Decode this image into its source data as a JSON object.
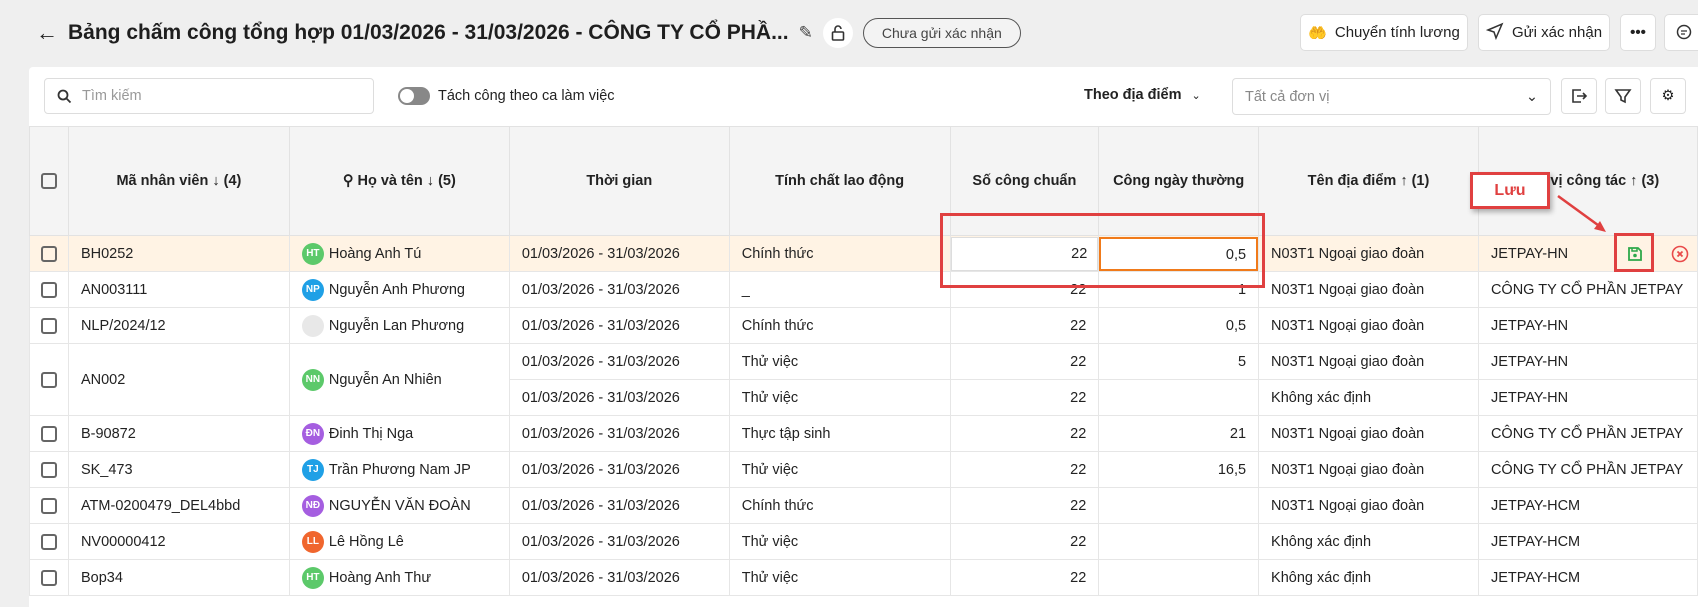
{
  "header": {
    "title": "Bảng chấm công tổng hợp 01/03/2026 - 31/03/2026 - CÔNG TY CỔ PHẦ...",
    "status": "Chưa gửi xác nhận",
    "transfer_label": "Chuyển tính lương",
    "send_label": "Gửi xác nhận"
  },
  "toolbar": {
    "search_placeholder": "Tìm kiếm",
    "split_toggle_label": "Tách công theo ca làm việc",
    "split_toggle_on": false,
    "group_by": "Theo địa điểm",
    "unit_placeholder": "Tất cả đơn vị"
  },
  "columns": [
    "Mã nhân viên ↓ (4)",
    "Họ và tên ↓ (5)",
    "Thời gian",
    "Tính chất lao động",
    "Số công chuẩn",
    "Công ngày thường",
    "Tên địa điểm ↑ (1)",
    "Đơn vị công tác ↑ (3)"
  ],
  "annotation": {
    "label": "Lưu",
    "color": "#e04040"
  },
  "colors": {
    "selected_row": "#fff3e4",
    "save": "#2ea84a",
    "cancel": "#e94a4a",
    "focus": "#f07a1a"
  },
  "rows": [
    {
      "code": "BH0252",
      "initials": "HT",
      "avatar_color": "#5cc96a",
      "name": "Hoàng Anh Tú",
      "period": "01/03/2026 - 31/03/2026",
      "type": "Chính thức",
      "standard": "22",
      "normal": "0,5",
      "location": "N03T1 Ngoại giao đoàn",
      "unit": "JETPAY-HN"
    },
    {
      "code": "AN003111",
      "initials": "NP",
      "avatar_color": "#1fa0e6",
      "name": "Nguyễn Anh Phương",
      "period": "01/03/2026 - 31/03/2026",
      "type": "_",
      "standard": "22",
      "normal": "1",
      "location": "N03T1 Ngoại giao đoàn",
      "unit": "CÔNG TY CỔ PHẦN JETPAY"
    },
    {
      "code": "NLP/2024/12",
      "initials": "",
      "avatar_color": "#e8e8e8",
      "name": "Nguyễn Lan Phương",
      "period": "01/03/2026 - 31/03/2026",
      "type": "Chính thức",
      "standard": "22",
      "normal": "0,5",
      "location": "N03T1 Ngoại giao đoàn",
      "unit": "JETPAY-HN"
    },
    {
      "code": "AN002",
      "initials": "NN",
      "avatar_color": "#5cc96a",
      "name": "Nguyễn An Nhiên",
      "sub": [
        {
          "period": "01/03/2026 - 31/03/2026",
          "type": "Thử việc",
          "standard": "22",
          "normal": "5",
          "location": "N03T1 Ngoại giao đoàn",
          "unit": "JETPAY-HN"
        },
        {
          "period": "01/03/2026 - 31/03/2026",
          "type": "Thử việc",
          "standard": "22",
          "normal": "",
          "location": "Không xác định",
          "unit": "JETPAY-HN"
        }
      ]
    },
    {
      "code": "B-90872",
      "initials": "ĐN",
      "avatar_color": "#a55ee0",
      "name": "Đinh Thị Nga",
      "period": "01/03/2026 - 31/03/2026",
      "type": "Thực tập sinh",
      "standard": "22",
      "normal": "21",
      "location": "N03T1 Ngoại giao đoàn",
      "unit": "CÔNG TY CỔ PHẦN JETPAY"
    },
    {
      "code": "SK_473",
      "initials": "TJ",
      "avatar_color": "#1fa0e6",
      "name": "Trần Phương Nam JP",
      "period": "01/03/2026 - 31/03/2026",
      "type": "Thử việc",
      "standard": "22",
      "normal": "16,5",
      "location": "N03T1 Ngoại giao đoàn",
      "unit": "CÔNG TY CỔ PHẦN JETPAY"
    },
    {
      "code": "ATM-0200479_DEL4bbd",
      "initials": "NĐ",
      "avatar_color": "#a55ee0",
      "name": "NGUYỄN VĂN ĐOÀN",
      "period": "01/03/2026 - 31/03/2026",
      "type": "Chính thức",
      "standard": "22",
      "normal": "",
      "location": "N03T1 Ngoại giao đoàn",
      "unit": "JETPAY-HCM"
    },
    {
      "code": "NV00000412",
      "initials": "LL",
      "avatar_color": "#f0662e",
      "name": "Lê Hồng Lê",
      "period": "01/03/2026 - 31/03/2026",
      "type": "Thử việc",
      "standard": "22",
      "normal": "",
      "location": "Không xác định",
      "unit": "JETPAY-HCM"
    },
    {
      "code": "Bop34",
      "initials": "HT",
      "avatar_color": "#5cc96a",
      "name": "Hoàng Anh Thư",
      "period": "01/03/2026 - 31/03/2026",
      "type": "Thử việc",
      "standard": "22",
      "normal": "",
      "location": "Không xác định",
      "unit": "JETPAY-HCM"
    }
  ]
}
